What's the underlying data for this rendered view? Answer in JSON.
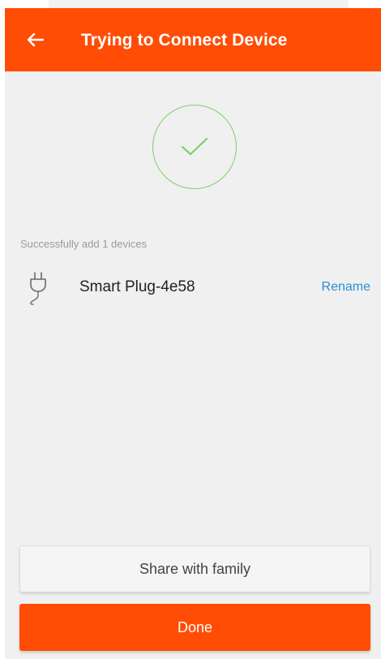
{
  "colors": {
    "accent": "#ff4d05",
    "background": "#f0f0f0",
    "success": "#7fcf6a",
    "link": "#2a8fd6"
  },
  "appbar": {
    "title": "Trying to Connect Device",
    "back_icon": "arrow-left-icon"
  },
  "status": {
    "icon": "checkmark-icon",
    "caption": "Successfully add 1 devices"
  },
  "device": {
    "icon": "plug-icon",
    "name": "Smart Plug-4e58",
    "rename_label": "Rename"
  },
  "actions": {
    "share_label": "Share with family",
    "done_label": "Done"
  }
}
